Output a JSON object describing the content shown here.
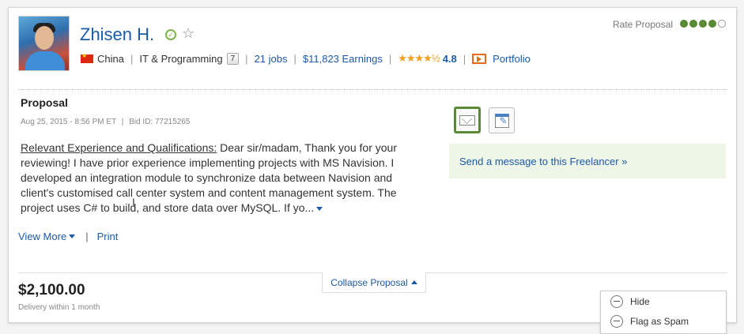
{
  "freelancer": {
    "name": "Zhisen H.",
    "country": "China",
    "category": "IT & Programming",
    "category_badge": "7",
    "jobs": "21 jobs",
    "earnings": "$11,823 Earnings",
    "rating_stars": "★★★★½",
    "rating": "4.8",
    "portfolio": "Portfolio"
  },
  "rate_proposal": {
    "label": "Rate Proposal",
    "value": 4,
    "max": 5
  },
  "proposal": {
    "title": "Proposal",
    "date": "Aug 25, 2015 - 8:56 PM ET",
    "bid_id": "Bid ID: 77215265",
    "heading": "Relevant Experience and Qualifications:",
    "text": " Dear sir/madam, Thank you for your reviewing! I have prior experience implementing projects with MS Navision. I developed an integration module to synchronize data between Navision and client's customised call center system and content management system. The project uses C# to build, and store data over MySQL. If yo...",
    "view_more": "View More",
    "print": "Print"
  },
  "actions": {
    "send_message": "Send a message to this Freelancer »"
  },
  "footer": {
    "collapse": "Collapse Proposal",
    "price": "$2,100.00",
    "delivery": "Delivery within 1 month"
  },
  "menu": {
    "hide": "Hide",
    "flag_spam": "Flag as Spam"
  },
  "colors": {
    "link": "#1c5aa6",
    "accent_green": "#5a8a34",
    "message_box_bg": "#eef6e8"
  }
}
